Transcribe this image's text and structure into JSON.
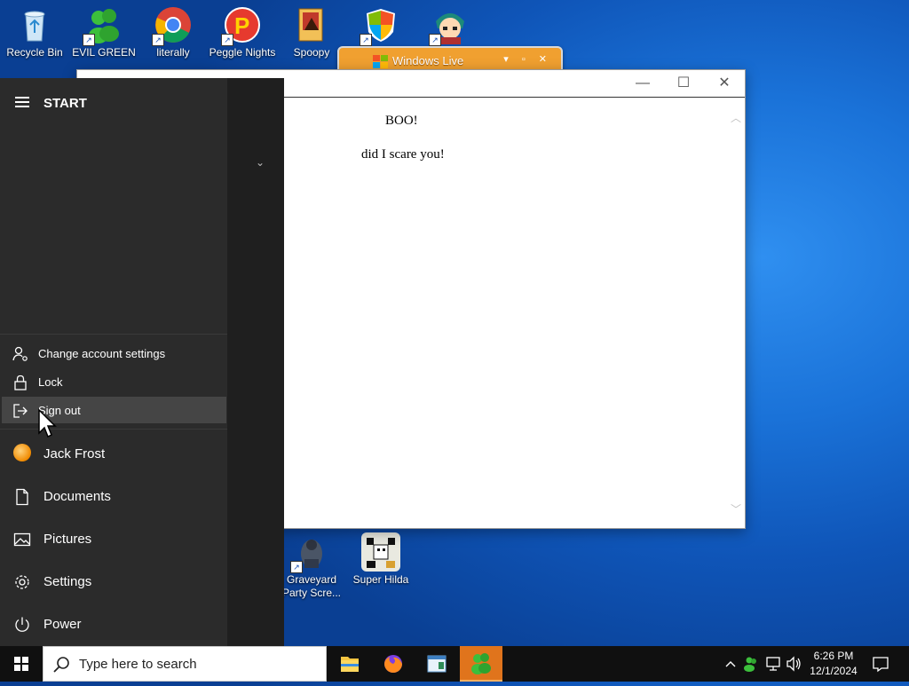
{
  "desktop_icons": [
    {
      "label": "Recycle Bin",
      "icon": "recycle-bin-icon"
    },
    {
      "label": "EVIL GREEN MEN GO",
      "icon": "green-men-icon"
    },
    {
      "label": "literally",
      "icon": "chrome-icon"
    },
    {
      "label": "Peggle Nights",
      "icon": "peggle-icon"
    },
    {
      "label": "Spoopy",
      "icon": "spoopy-icon"
    },
    {
      "label": "",
      "icon": "windows-shield-icon"
    },
    {
      "label": "",
      "icon": "anime-character-icon"
    },
    {
      "label": "Graveyard Party Scre...",
      "icon": "graveyard-icon"
    },
    {
      "label": "Super Hilda",
      "icon": "super-hilda-icon"
    }
  ],
  "live_window": {
    "title": "Windows Live"
  },
  "document": {
    "heading": "BOO!",
    "body": "did I scare you!"
  },
  "start_menu": {
    "title": "START",
    "account_menu": [
      {
        "label": "Change account settings",
        "icon": "account-settings-icon"
      },
      {
        "label": "Lock",
        "icon": "lock-icon"
      },
      {
        "label": "Sign out",
        "icon": "sign-out-icon"
      }
    ],
    "user_name": "Jack Frost",
    "items": [
      {
        "label": "Documents",
        "icon": "document-icon"
      },
      {
        "label": "Pictures",
        "icon": "pictures-icon"
      },
      {
        "label": "Settings",
        "icon": "gear-icon"
      },
      {
        "label": "Power",
        "icon": "power-icon"
      }
    ]
  },
  "taskbar": {
    "search_placeholder": "Type here to search",
    "time": "6:26 PM",
    "date": "12/1/2024"
  },
  "colors": {
    "accent": "#e0741c",
    "start_bg": "#2b2b2b",
    "taskbar_bg": "#101010"
  }
}
